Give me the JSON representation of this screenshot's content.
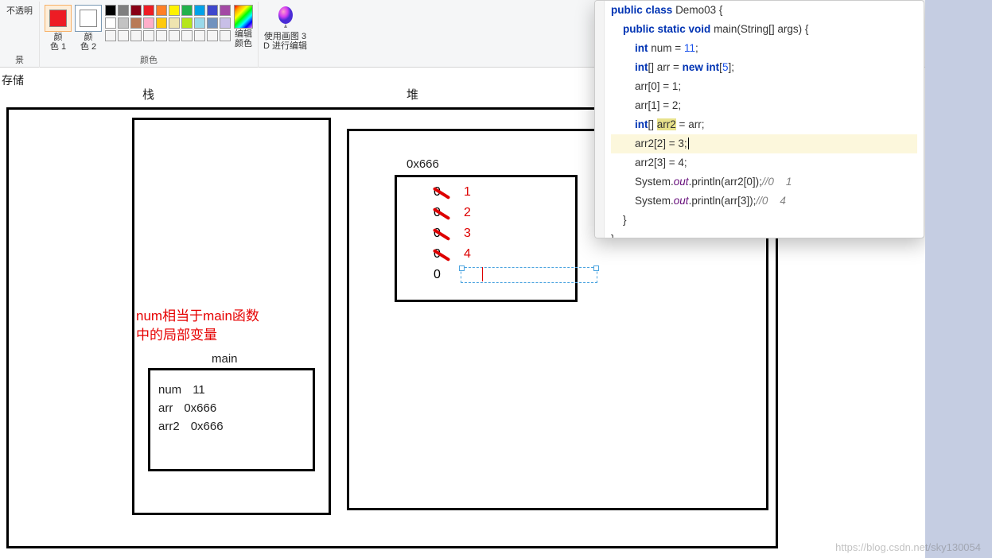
{
  "ribbon": {
    "transparent": "不透明",
    "color1": {
      "label": "颜\n色 1",
      "hex": "#ed1c24"
    },
    "color2": {
      "label": "颜\n色 2",
      "hex": "#ffffff"
    },
    "palette_row1": [
      "#000000",
      "#7f7f7f",
      "#880015",
      "#ed1c24",
      "#ff7f27",
      "#fff200",
      "#22b14c",
      "#00a2e8",
      "#3f48cc",
      "#a349a4"
    ],
    "palette_row2": [
      "#ffffff",
      "#c3c3c3",
      "#b97a57",
      "#ffaec9",
      "#ffc90e",
      "#efe4b0",
      "#b5e61d",
      "#99d9ea",
      "#7092be",
      "#c8bfe7"
    ],
    "palette_row3": [
      "#f5f5f5",
      "#f5f5f5",
      "#f5f5f5",
      "#f5f5f5",
      "#f5f5f5",
      "#f5f5f5",
      "#f5f5f5",
      "#f5f5f5",
      "#f5f5f5",
      "#f5f5f5"
    ],
    "group_colors_label": "颜色",
    "edit_color": "编辑\n颜色",
    "paint3d": "使用画图 3\nD 进行编辑",
    "bg_label": "景"
  },
  "canvas": {
    "title": "存储",
    "stack_title": "栈",
    "heap_title": "堆",
    "red_note_l1": "num相当于main函数",
    "red_note_l2": "中的局部变量",
    "main_label": "main",
    "main_vars": [
      {
        "name": "num",
        "val": "11"
      },
      {
        "name": "arr",
        "val": "0x666"
      },
      {
        "name": "arr2",
        "val": "0x666"
      }
    ],
    "heap_addr": "0x666",
    "heap_arr": [
      {
        "old": "0",
        "new": "1",
        "struck": true
      },
      {
        "old": "0",
        "new": "2",
        "struck": true
      },
      {
        "old": "0",
        "new": "3",
        "struck": true
      },
      {
        "old": "0",
        "new": "4",
        "struck": true
      },
      {
        "old": "0",
        "new": "",
        "struck": false
      }
    ]
  },
  "code": {
    "class_kw": "public class",
    "class_name": "Demo03",
    "main_sig_kw": "public static void",
    "main_name": "main",
    "main_args": "(String[] args)",
    "l1_ty": "int",
    "l1_name": "num",
    "l1_val": "11",
    "l2_ty": "int",
    "l2_name": "arr",
    "l2_new": "new int",
    "l2_size": "5",
    "l3": "arr[0] = 1;",
    "l4": "arr[1] = 2;",
    "l5_ty": "int",
    "l5_lhs": "arr2",
    "l5_rhs": "arr",
    "l6": "arr2[2] = 3;",
    "l7": "arr2[3] = 4;",
    "l8_pre": "System.",
    "l8_out": "out",
    "l8_post": ".println(arr2[0]);",
    "l8_cm": "//0    1",
    "l9_pre": "System.",
    "l9_out": "out",
    "l9_post": ".println(arr[3]);",
    "l9_cm": "//0    4"
  },
  "watermark": "https://blog.csdn.net/sky130054"
}
